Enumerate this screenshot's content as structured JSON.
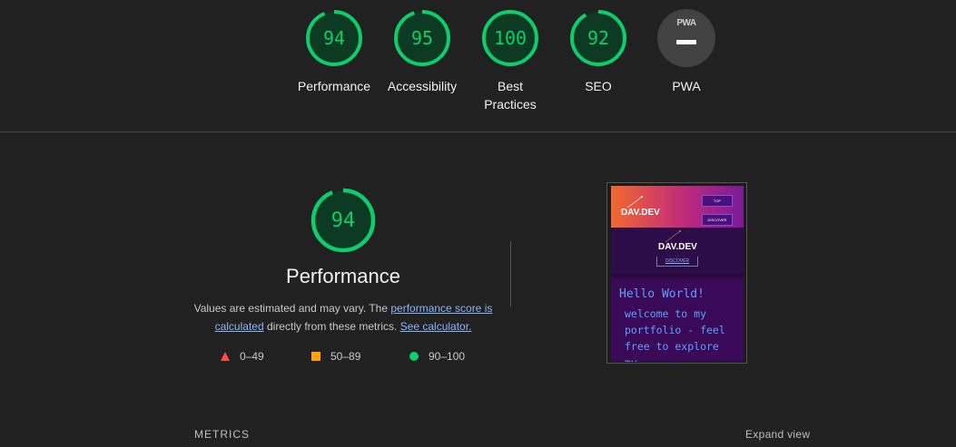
{
  "categories": [
    {
      "key": "performance",
      "score": "94",
      "label": "Performance",
      "value": 0.94
    },
    {
      "key": "accessibility",
      "score": "95",
      "label": "Accessibility",
      "value": 0.95
    },
    {
      "key": "best_practices",
      "score": "100",
      "label": "Best Practices",
      "value": 1.0
    },
    {
      "key": "seo",
      "score": "92",
      "label": "SEO",
      "value": 0.92
    },
    {
      "key": "pwa",
      "score": "",
      "label": "PWA",
      "badge_text": "PWA"
    }
  ],
  "performance": {
    "score": "94",
    "value": 0.94,
    "title": "Performance",
    "desc_prefix": "Values are estimated and may vary. The ",
    "link1": "performance score is calculated",
    "desc_middle": " directly from these metrics. ",
    "link2": "See calculator."
  },
  "legend": [
    {
      "range": "0–49",
      "icon": "fail-triangle-icon",
      "color": "#ff4e42"
    },
    {
      "range": "50–89",
      "icon": "average-square-icon",
      "color": "#ffa400"
    },
    {
      "range": "90–100",
      "icon": "pass-circle-icon",
      "color": "#0cce6b"
    }
  ],
  "screenshot": {
    "logo": "DAV.DEV",
    "btn_top": "TOP",
    "btn_discover": "DISCOVER",
    "discover_link": "DISCOVER",
    "hello": "Hello World!",
    "welcome": "welcome to my portfolio - feel free to explore my"
  },
  "metrics_label": "METRICS",
  "expand_label": "Expand view",
  "colors": {
    "pass": "#0cce6b",
    "background": "#212121"
  }
}
